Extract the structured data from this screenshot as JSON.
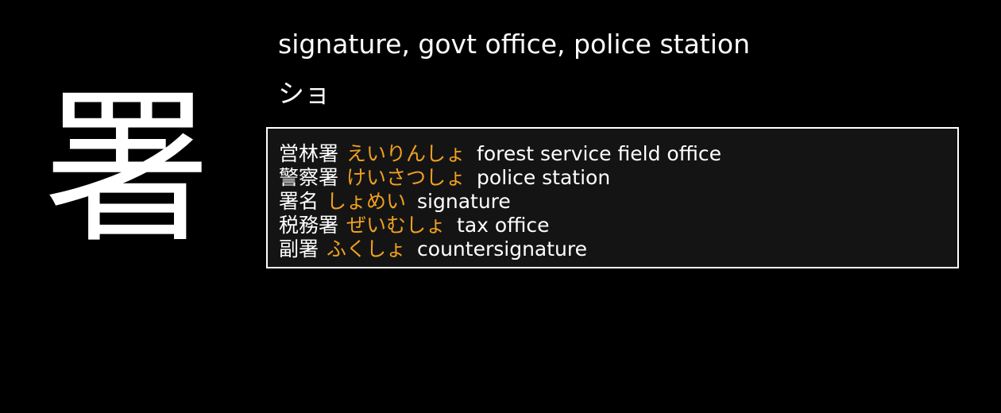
{
  "kanji": "署",
  "meaning": "signature, govt office, police station",
  "onyomi": "ショ",
  "colors": {
    "background": "#000000",
    "text": "#ffffff",
    "reading": "#f0a020",
    "box_background": "#141414",
    "box_border": "#ffffff"
  },
  "vocab": [
    {
      "word": "営林署",
      "reading": "えいりんしょ",
      "gloss": "forest service field office"
    },
    {
      "word": "警察署",
      "reading": "けいさつしょ",
      "gloss": "police station"
    },
    {
      "word": "署名",
      "reading": "しょめい",
      "gloss": "signature"
    },
    {
      "word": "税務署",
      "reading": "ぜいむしょ",
      "gloss": "tax office"
    },
    {
      "word": "副署",
      "reading": "ふくしょ",
      "gloss": "countersignature"
    }
  ]
}
